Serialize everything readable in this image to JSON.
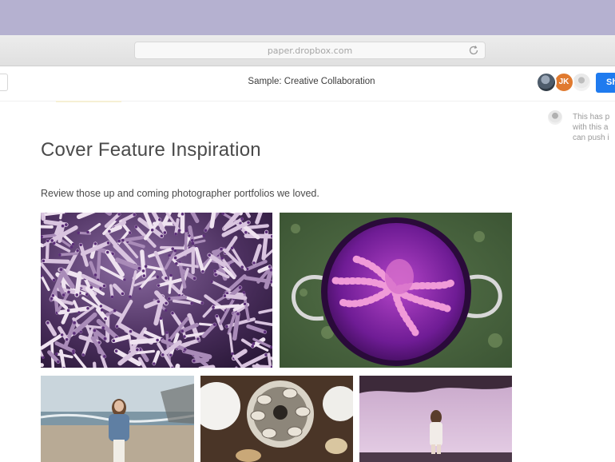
{
  "browser": {
    "url": "paper.dropbox.com"
  },
  "header": {
    "doc_title": "Sample: Creative Collaboration",
    "avatar_initials": "JK",
    "share_label": "Sh"
  },
  "comment": {
    "lines": [
      "This has p",
      "with this a",
      "can push i"
    ]
  },
  "document": {
    "title": "Cover Feature Inspiration",
    "intro": "Review those up and coming photographer portfolios we loved."
  },
  "colors": {
    "top_band": "#b5b1d0",
    "share_button": "#1f7bef",
    "avatar_orange": "#e07a2f"
  },
  "photos": [
    {
      "name": "sea-urchin-photo"
    },
    {
      "name": "octopus-in-pot-photo"
    },
    {
      "name": "woman-on-beach-photo"
    },
    {
      "name": "oysters-table-photo"
    },
    {
      "name": "woman-sunset-photo"
    }
  ]
}
